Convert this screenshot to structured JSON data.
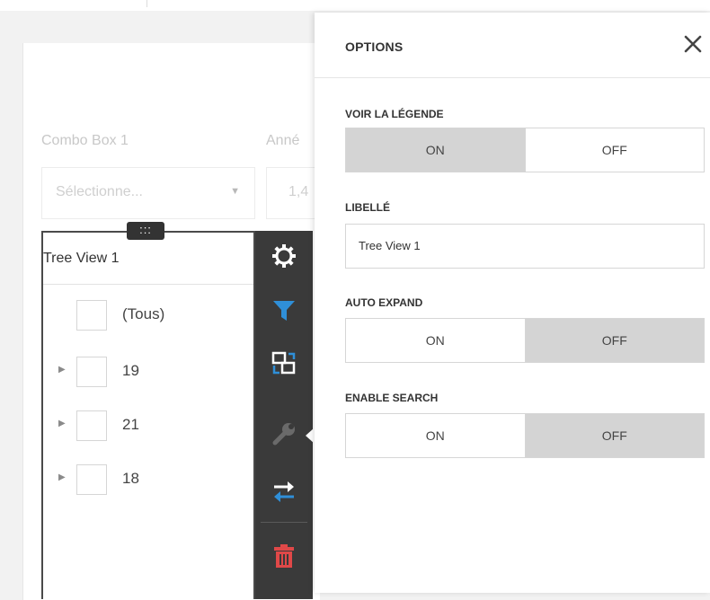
{
  "dashboard": {
    "combo_label": "Combo Box 1",
    "combo_placeholder": "Sélectionne...",
    "second_label": "Anné",
    "second_value": "1,4",
    "drag_handle": ":::"
  },
  "tree_view": {
    "title": "Tree View 1",
    "items": [
      {
        "label": "(Tous)",
        "expandable": false
      },
      {
        "label": "19",
        "expandable": true
      },
      {
        "label": "21",
        "expandable": true
      },
      {
        "label": "18",
        "expandable": true
      }
    ]
  },
  "toolbar": {
    "icons": [
      "gear-icon",
      "filter-icon",
      "convert-icon",
      "wrench-icon",
      "swap-icon",
      "trash-icon"
    ],
    "colors": {
      "filter": "#2f8fd8",
      "swap": "#2f8fd8",
      "trash": "#e04848",
      "wrench": "#6a6a6a"
    }
  },
  "options": {
    "title": "OPTIONS",
    "sections": {
      "legend": {
        "label": "VOIR LA LÉGENDE",
        "on": "ON",
        "off": "OFF",
        "selected": "on"
      },
      "libelle": {
        "label": "LIBELLÉ",
        "value": "Tree View 1"
      },
      "auto_expand": {
        "label": "AUTO EXPAND",
        "on": "ON",
        "off": "OFF",
        "selected": "off"
      },
      "enable_search": {
        "label": "ENABLE SEARCH",
        "on": "ON",
        "off": "OFF",
        "selected": "off"
      }
    }
  }
}
